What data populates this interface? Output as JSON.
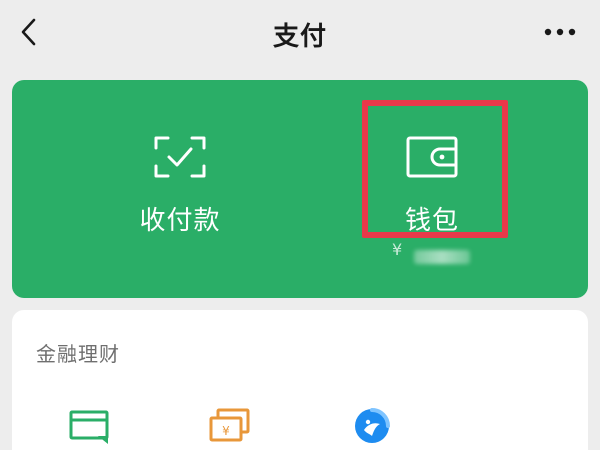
{
  "header": {
    "title": "支付",
    "back_icon": "chevron-left-icon",
    "more_icon": "more-horizontal-icon"
  },
  "pay_panel": {
    "accent_color": "#2aae67",
    "highlight_color": "#e8394a",
    "collect_pay": {
      "label": "收付款",
      "icon": "scan-check-icon"
    },
    "wallet": {
      "label": "钱包",
      "icon": "wallet-icon",
      "balance_symbol": "¥"
    }
  },
  "finance_section": {
    "title": "金融理财",
    "items": [
      {
        "icon": "card-icon",
        "color": "#2aae67"
      },
      {
        "icon": "wealth-yen-icon",
        "color": "#e8973a"
      },
      {
        "icon": "fund-icon",
        "color": "#1e8cf0"
      }
    ]
  }
}
